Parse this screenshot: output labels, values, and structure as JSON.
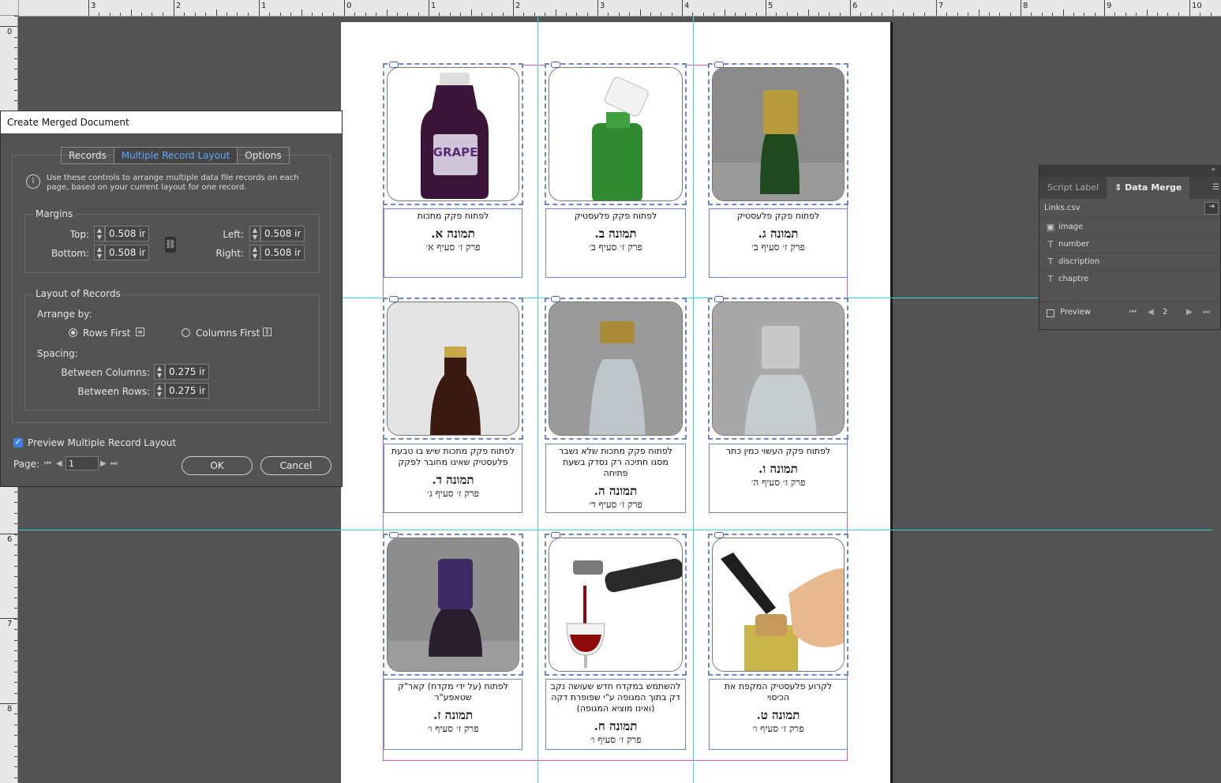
{
  "rulers": {
    "horizontal": [
      "3",
      "2",
      "1",
      "0",
      "1",
      "2",
      "3",
      "4",
      "5",
      "6",
      "7",
      "8",
      "9",
      "10"
    ],
    "vertical": [
      "0",
      "6",
      "7",
      "8"
    ]
  },
  "cards": [
    {
      "desc": "לפתוח פקק מתכות",
      "number": "תמונה א.",
      "chapter": "פרק ז׳ סעיף א׳",
      "image": "grape-juice-bottle"
    },
    {
      "desc": "לפתוח פקק פלעסטיק",
      "number": "תמונה ב.",
      "chapter": "פרק ז׳ סעיף ב׳",
      "image": "green-bottle-plastic-cap"
    },
    {
      "desc": "לפתוח פקק פלעסטיק",
      "number": "תמונה ג.",
      "chapter": "פרק ז׳ סעיף ב׳",
      "image": "green-bottle-metal-cap"
    },
    {
      "desc": "לפתוח פקק מתכות שיש בו טבעת פלעסטיק שאינו מחובר לפקק",
      "number": "תמונה ד.",
      "chapter": "פרק ז׳ סעיף ג׳",
      "image": "brown-beer-bottle"
    },
    {
      "desc": "לפתוח פקק מתכות שלא נשבר מסגו חתיכה רק נסדק בשעת פתיחה",
      "number": "תמונה ה.",
      "chapter": "פרק ז׳ סעיף ד׳",
      "image": "clear-bottle-gold-cap"
    },
    {
      "desc": "לפתוח פקק העשוי כמין כתר",
      "number": "תמונה ו.",
      "chapter": "פרק ז׳ סעיף ה׳",
      "image": "clear-bottle-silver-cap"
    },
    {
      "desc": "לפתוח (על ידי מקדח) קאר\"ק שטאפע\"ר",
      "number": "תמונה ז.",
      "chapter": "פרק ז׳ סעיף ו׳",
      "image": "purple-capped-bottle"
    },
    {
      "desc": "להשתמש במקדח חדש שעושה נקב דק בתוך המגופה ע\"י שפופרת דקה (ואינו מוציא המגופה)",
      "number": "תמונה ח.",
      "chapter": "פרק ז׳ סעיף ו׳",
      "image": "wine-pouring-opener"
    },
    {
      "desc": "לקרוע פלעסטיק המקפת את הכיסוי",
      "number": "תמונה ט.",
      "chapter": "פרק ז׳ סעיף ו׳",
      "image": "corkscrew-in-hand"
    }
  ],
  "dialog": {
    "title": "Create Merged Document",
    "tabs": [
      "Records",
      "Multiple Record Layout",
      "Options"
    ],
    "active_tab": "Multiple Record Layout",
    "info_text": "Use these controls to arrange multiple data file records on each page, based on your current layout for one record.",
    "margins_label": "Margins",
    "top_label": "Top:",
    "bottom_label": "Bottom:",
    "left_label": "Left:",
    "right_label": "Right:",
    "top": "0.508 in",
    "bottom": "0.508 in",
    "left": "0.508 in",
    "right": "0.508 in",
    "layout_label": "Layout of Records",
    "arrange_label": "Arrange by:",
    "rows_first": "Rows First",
    "columns_first": "Columns First",
    "arrange_selected": "Rows First",
    "spacing_label": "Spacing:",
    "between_columns_label": "Between Columns:",
    "between_rows_label": "Between Rows:",
    "between_columns": "0.275 in",
    "between_rows": "0.275 in",
    "preview_label": "Preview Multiple Record Layout",
    "preview_checked": true,
    "page_label": "Page:",
    "page_value": "1",
    "ok": "OK",
    "cancel": "Cancel"
  },
  "panel": {
    "tabs": [
      "Script Label",
      "Data Merge"
    ],
    "active_tab": "Data Merge",
    "csv": "Links.csv",
    "fields": [
      {
        "type": "image-icon",
        "name": "image"
      },
      {
        "type": "text-icon",
        "name": "number"
      },
      {
        "type": "text-icon",
        "name": "discription"
      },
      {
        "type": "text-icon",
        "name": "chaptre"
      }
    ],
    "preview_label": "Preview",
    "record": "2"
  },
  "colors": {
    "guide": "#3ad6d6",
    "margin": "#d45bd4",
    "frame": "#6d86c4",
    "accent_tab": "#5fa8ff",
    "checkbox": "#3d7fe0"
  }
}
